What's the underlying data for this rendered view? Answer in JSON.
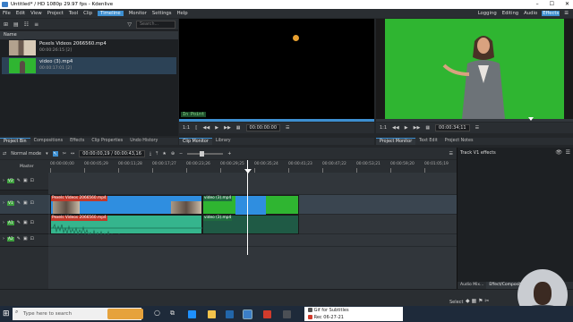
{
  "window": {
    "title": "Untitled* / HD 1080p 29.97 fps - Kdenlive",
    "minimize": "–",
    "maximize": "☐",
    "close": "✕"
  },
  "menu": {
    "items": [
      "File",
      "Edit",
      "View",
      "Project",
      "Tool",
      "Clip"
    ],
    "active": "Timeline",
    "items_after": [
      "Monitor",
      "Settings",
      "Help"
    ],
    "layouts": [
      "Logging",
      "Editing",
      "Audio",
      "Effects"
    ],
    "selected_layout": "Effects"
  },
  "bin": {
    "search_placeholder": "Search...",
    "column_header": "Name",
    "clips": [
      {
        "name": "Pexels Videos 2066560.mp4",
        "meta": "00:00:26:15 [2]"
      },
      {
        "name": "video (3).mp4",
        "meta": "00:00:17:01 [2]"
      }
    ],
    "tabs": [
      "Project Bin",
      "Compositions",
      "Effects",
      "Clip Properties",
      "Undo History"
    ],
    "active_tab": "Project Bin"
  },
  "clip_monitor": {
    "in_point": "In Point",
    "zoom": "1:1",
    "timecode": "00:00:00:00",
    "tabs": [
      "Clip Monitor",
      "Library"
    ],
    "active_tab": "Clip Monitor"
  },
  "project_monitor": {
    "zoom": "1:1",
    "timecode": "00:00:34;11",
    "tabs": [
      "Project Monitor",
      "Text Edit",
      "Project Notes"
    ],
    "active_tab": "Project Monitor"
  },
  "timeline": {
    "mode": "Normal mode",
    "position": "00:00:00,19 / 00:00:43,16",
    "master_label": "Master",
    "ruler_ticks": [
      "00:00:00;00",
      "00:00:05;29",
      "00:00:11;28",
      "00:00:17;27",
      "00:00:23;26",
      "00:00:29;25",
      "00:00:35;24",
      "00:00:41;23",
      "00:00:47;22",
      "00:00:53;21",
      "00:00:59;20",
      "00:01:05;19"
    ],
    "playhead_label": "00:00:00:19",
    "tracks": [
      {
        "id": "V2",
        "type": "video"
      },
      {
        "id": "V1",
        "type": "video"
      },
      {
        "id": "A1",
        "type": "audio"
      },
      {
        "id": "A2",
        "type": "audio"
      }
    ],
    "clips": [
      {
        "label": "Pexels Videos 2066560.mp4"
      },
      {
        "label": "video (3).mp4"
      },
      {
        "label": "Pexels Videos 2066560.mp4"
      },
      {
        "label": "video (3).mp4"
      }
    ]
  },
  "effects_panel": {
    "title": "Track V1 effects",
    "tabs": [
      "Audio Mix...",
      "Effect/Composition..."
    ],
    "active_tab": "Effect/Composition..."
  },
  "bottom_left": {
    "select": "Select"
  },
  "taskbar": {
    "search": "Type here to search",
    "windows": [
      {
        "label": "Gif for Subtitles"
      },
      {
        "label": "Rec 06-27-21"
      }
    ]
  },
  "colors": {
    "accent": "#3d8fd1",
    "video_clip": "#2f8ee0",
    "audio_clip": "#35b58d",
    "green_screen": "#2fb531"
  }
}
